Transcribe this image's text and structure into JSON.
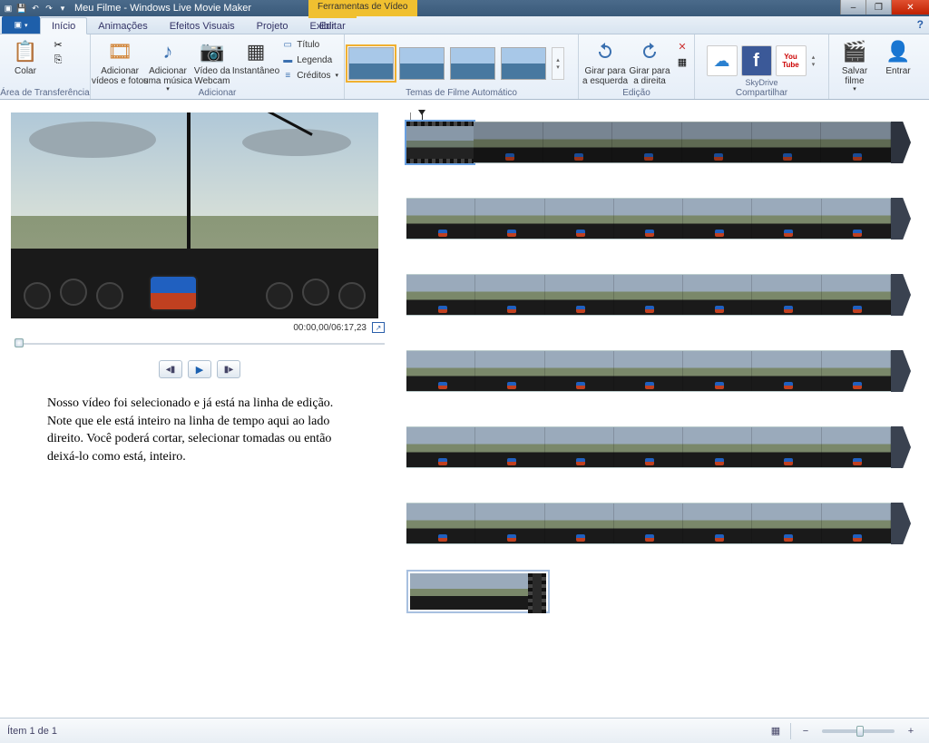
{
  "title": "Meu Filme - Windows Live Movie Maker",
  "tools_context": "Ferramentas de Vídeo",
  "window_buttons": {
    "min": "–",
    "max": "❐",
    "close": "✕"
  },
  "tabs": {
    "inicio": "Início",
    "animacoes": "Animações",
    "efeitos": "Efeitos Visuais",
    "projeto": "Projeto",
    "exibir": "Exibir",
    "editar": "Editar"
  },
  "ribbon": {
    "clipboard": {
      "label": "Área de Transferência",
      "paste": "Colar"
    },
    "add": {
      "label": "Adicionar",
      "videos": "Adicionar\nvídeos e fotos",
      "music": "Adicionar\numa música",
      "webcam": "Vídeo da\nWebcam",
      "snapshot": "Instantâneo",
      "title": "Título",
      "legend": "Legenda",
      "credits": "Créditos"
    },
    "themes": {
      "label": "Temas de Filme Automático"
    },
    "edit": {
      "label": "Edição",
      "rotate_left": "Girar para\na esquerda",
      "rotate_right": "Girar para\na direita"
    },
    "share": {
      "label": "Compartilhar",
      "skydrive": "SkyDrive",
      "save": "Salvar\nfilme",
      "signin": "Entrar"
    }
  },
  "preview": {
    "time": "00:00,00/06:17,23"
  },
  "caption": "Nosso vídeo foi selecionado e já está na linha de edição. Note que ele está inteiro na linha de tempo aqui ao lado direito. Você poderá cortar, selecionar tomadas ou então deixá-lo como está, inteiro.",
  "status": {
    "item": "Ítem 1 de 1"
  }
}
